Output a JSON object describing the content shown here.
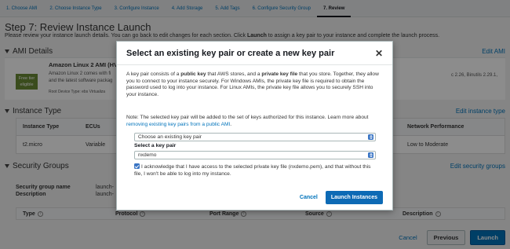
{
  "steps": [
    {
      "label": "1. Choose AMI"
    },
    {
      "label": "2. Choose Instance Type"
    },
    {
      "label": "3. Configure Instance"
    },
    {
      "label": "4. Add Storage"
    },
    {
      "label": "5. Add Tags"
    },
    {
      "label": "6. Configure Security Group"
    },
    {
      "label": "7. Review"
    }
  ],
  "page": {
    "title": "Step 7: Review Instance Launch",
    "subtitle_pre": "Please review your instance launch details. You can go back to edit changes for each section. Click ",
    "subtitle_bold": "Launch",
    "subtitle_post": " to assign a key pair to your instance and complete the launch process."
  },
  "ami": {
    "section_title": "AMI Details",
    "edit_label": "Edit AMI",
    "name": "Amazon Linux 2 AMI (HVM",
    "desc_line1": "Amazon Linux 2 comes with fi",
    "desc_line2": "and the latest software packag",
    "free_tier_l1": "Free tier",
    "free_tier_l2": "eligible",
    "root_device": "Root Device Type: ebs    Virtualiza",
    "right_text_l1": "c 2.26, Binutils 2.29.1,"
  },
  "instance_type": {
    "section_title": "Instance Type",
    "edit_label": "Edit instance type",
    "headers": [
      "Instance Type",
      "ECUs",
      "Network Performance"
    ],
    "row": [
      "t2.micro",
      "Variable",
      "Low to Moderate"
    ]
  },
  "security_groups": {
    "section_title": "Security Groups",
    "edit_label": "Edit security groups",
    "name_label": "Security group name",
    "desc_label": "Description",
    "name_value": "launch-",
    "desc_value": "launch-",
    "headers": [
      "Type",
      "Protocol",
      "Port Range",
      "Source",
      "Description"
    ],
    "info_glyph": "i"
  },
  "bottom": {
    "cancel_label": "Cancel",
    "previous_label": "Previous",
    "launch_label": "Launch"
  },
  "modal": {
    "title": "Select an existing key pair or create a new key pair",
    "close_glyph": "✕",
    "p1_a": "A key pair consists of a ",
    "p1_b": "public key",
    "p1_c": " that AWS stores, and a ",
    "p1_d": "private key file",
    "p1_e": " that you store. Together, they allow you to connect to your instance securely. For Windows AMIs, the private key file is required to obtain the password used to log into your instance. For Linux AMIs, the private key file allows you to securely SSH into your instance.",
    "p2_a": "Note: The selected key pair will be added to the set of keys authorized for this instance. Learn more about ",
    "p2_link": "removing existing key pairs from a public AMI",
    "p2_end": ".",
    "choose_select_value": "Choose an existing key pair",
    "key_pair_label": "Select a key pair",
    "key_pair_value": "nxdemo",
    "ack_text": "I acknowledge that I have access to the selected private key file (nxdemo.pem), and that without this file, I won't be able to log into my instance.",
    "cancel_label": "Cancel",
    "launch_label": "Launch Instances"
  },
  "colors": {
    "accent": "#0073bb",
    "primary_button": "#0d6ab5",
    "free_tier": "#6b8a36"
  }
}
